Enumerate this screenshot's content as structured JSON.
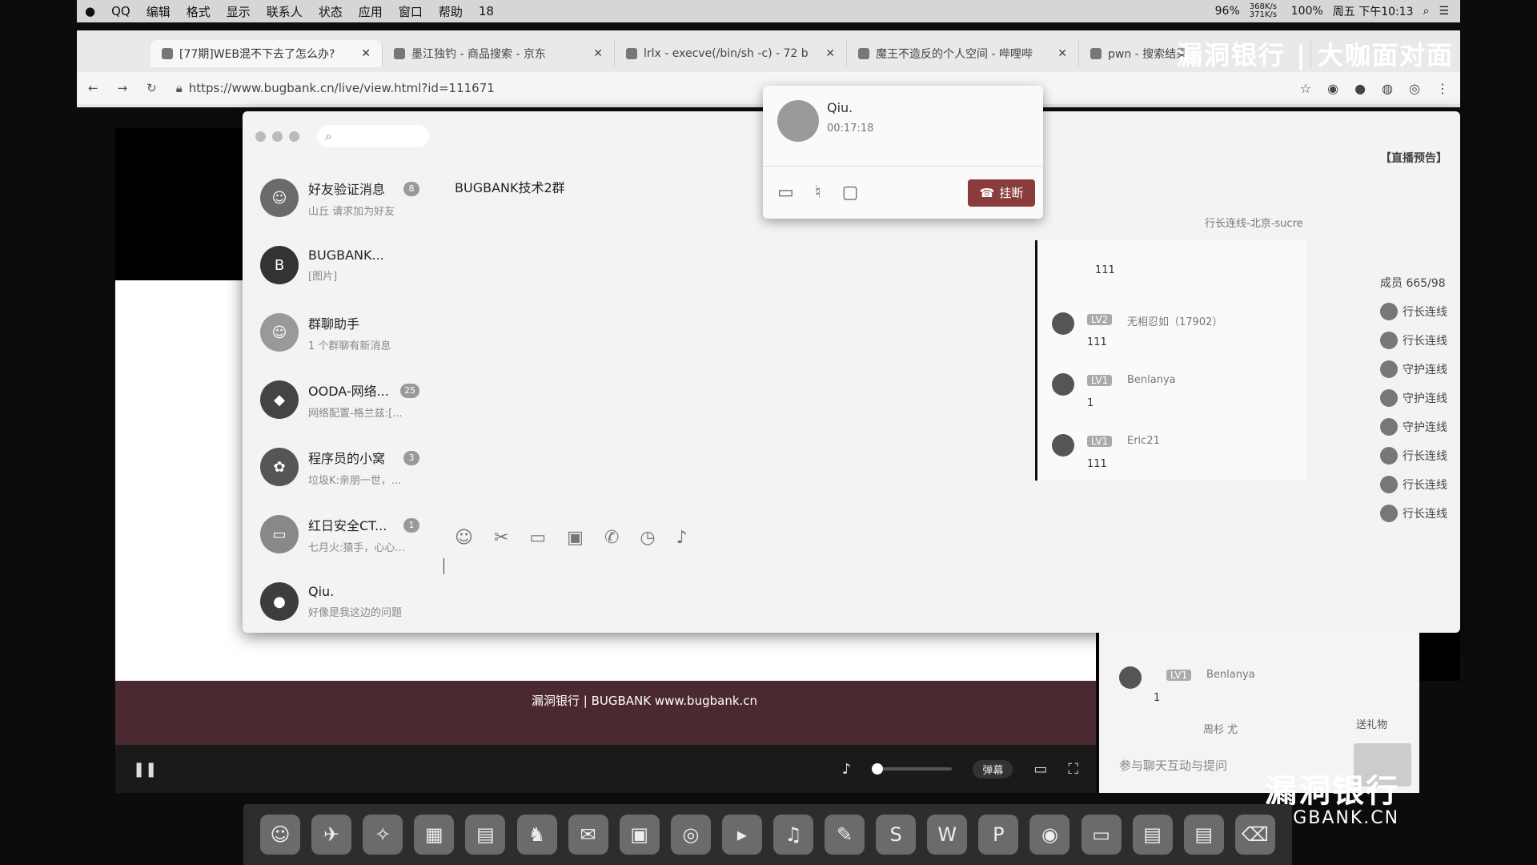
{
  "menubar": {
    "apple": "",
    "items": [
      "QQ",
      "编辑",
      "格式",
      "显示",
      "联系人",
      "状态",
      "应用",
      "窗口",
      "帮助"
    ],
    "qq_badge": "18",
    "battery": "96%",
    "net": "368K/s 371K/s",
    "volume": "100%",
    "clock": "周五 下午10:13"
  },
  "browser": {
    "tabs": [
      {
        "title": "[77期]WEB混不下去了怎么办?",
        "active": true
      },
      {
        "title": "墨江独钓 - 商品搜索 - 京东",
        "active": false
      },
      {
        "title": "lrlx - execve(/bin/sh -c) - 72 b",
        "active": false
      },
      {
        "title": "魔王不造反的个人空间 - 哔哩哔",
        "active": false
      },
      {
        "title": "pwn - 搜索结果",
        "active": false
      }
    ],
    "url": "https://www.bugbank.cn/live/view.html?id=111671"
  },
  "qq": {
    "search_placeholder": "",
    "conversations": [
      {
        "name": "好友验证消息",
        "preview": "山丘 请求加为好友",
        "badge": "8"
      },
      {
        "name": "BUGBANK...",
        "preview": "[图片]",
        "badge": ""
      },
      {
        "name": "群聊助手",
        "preview": "1 个群聊有新消息",
        "badge": ""
      },
      {
        "name": "OODA-网络...",
        "preview": "网络配置-格兰兹:[...",
        "badge": "25"
      },
      {
        "name": "程序员的小窝",
        "preview": "垃圾K:亲朋一世，...",
        "badge": "3"
      },
      {
        "name": "红日安全CT...",
        "preview": "七月火:猿手，心心...",
        "badge": "1"
      },
      {
        "name": "Qiu.",
        "preview": "好像是我这边的问题",
        "badge": ""
      }
    ],
    "chat_title": "BUGBANK技术2群",
    "call": {
      "name": "Qiu.",
      "time": "00:17:18",
      "hangup": "挂断"
    }
  },
  "live": {
    "chat_msgs": [
      {
        "level": "LV2",
        "name": "无相忍如（17902）",
        "text": "111"
      },
      {
        "level": "LV1",
        "name": "Benlanya",
        "text": "1"
      },
      {
        "level": "LV1",
        "name": "Eric21",
        "text": "111"
      }
    ],
    "first_text": "111",
    "route": "行长连线-北京-sucre",
    "preview_title": "【直播预告】",
    "members": "成员 665/98",
    "member_tag": "行长连线",
    "guard_tag": "守护连线",
    "banner": "漏洞银行 | BUGBANK www.bugbank.cn",
    "danmu": "弹幕",
    "chat_placeholder": "参与聊天互动与提问",
    "gift": "送礼物",
    "side_msg": {
      "level": "LV1",
      "name": "Benlanya",
      "text": "1"
    },
    "side_user": "周杉 尤"
  },
  "watermark": {
    "cn": "漏洞银行",
    "en": "BUGBANK.CN",
    "top": "漏洞银行 | 大咖面对面"
  }
}
